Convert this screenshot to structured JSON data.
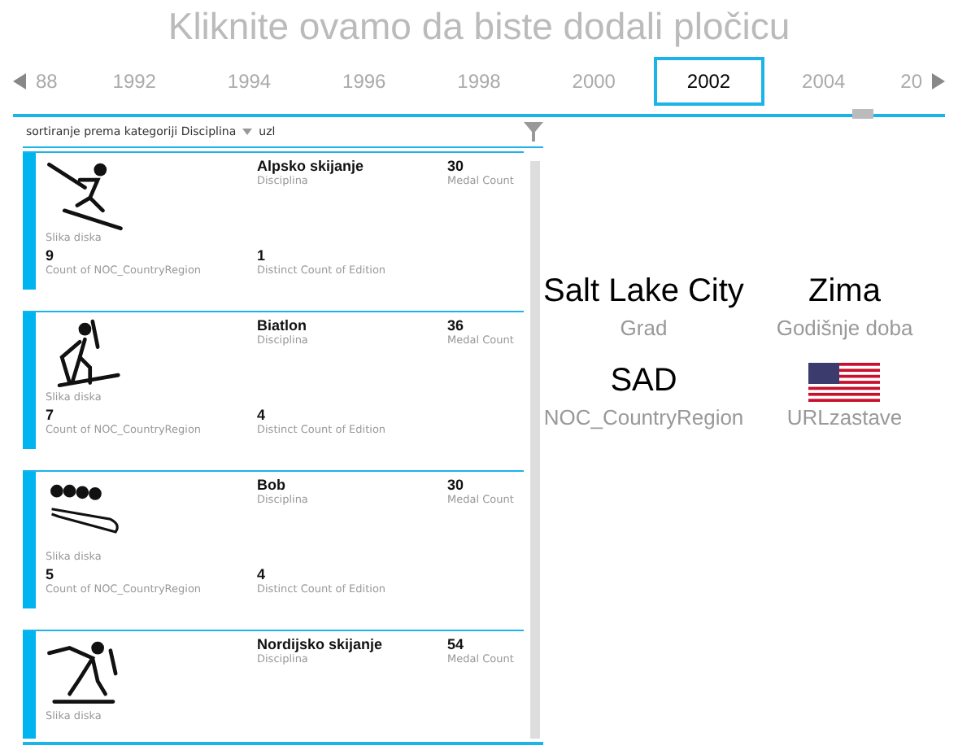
{
  "title": "Kliknite ovamo da biste dodali pločicu",
  "timeline": {
    "years": [
      {
        "label": "88",
        "selected": false
      },
      {
        "label": "1992",
        "selected": false
      },
      {
        "label": "1994",
        "selected": false
      },
      {
        "label": "1996",
        "selected": false
      },
      {
        "label": "1998",
        "selected": false
      },
      {
        "label": "2000",
        "selected": false
      },
      {
        "label": "2002",
        "selected": true
      },
      {
        "label": "2004",
        "selected": false
      },
      {
        "label": "20",
        "selected": false
      }
    ]
  },
  "sort": {
    "label": "sortiranje prema kategoriji Disciplina",
    "order": "uzl"
  },
  "cards": [
    {
      "kind": "alpine",
      "image_label": "Slika diska",
      "name": "Alpsko skijanje",
      "name_label": "Disciplina",
      "medals": "30",
      "medals_label": "Medal Count",
      "countries": "9",
      "countries_label": "Count of NOC_CountryRegion",
      "editions": "1",
      "editions_label": "Distinct Count of Edition"
    },
    {
      "kind": "biathlon",
      "image_label": "Slika diska",
      "name": "Biatlon",
      "name_label": "Disciplina",
      "medals": "36",
      "medals_label": "Medal Count",
      "countries": "7",
      "countries_label": "Count of NOC_CountryRegion",
      "editions": "4",
      "editions_label": "Distinct Count of Edition"
    },
    {
      "kind": "bobsleigh",
      "image_label": "Slika diska",
      "name": "Bob",
      "name_label": "Disciplina",
      "medals": "30",
      "medals_label": "Medal Count",
      "countries": "5",
      "countries_label": "Count of NOC_CountryRegion",
      "editions": "4",
      "editions_label": "Distinct Count of Edition"
    },
    {
      "kind": "nordic",
      "image_label": "Slika diska",
      "name": "Nordijsko skijanje",
      "name_label": "Disciplina",
      "medals": "54",
      "medals_label": "Medal Count"
    }
  ],
  "details": [
    {
      "kind": "text",
      "value": "Salt Lake City",
      "label": "Grad"
    },
    {
      "kind": "text",
      "value": "Zima",
      "label": "Godišnje doba"
    },
    {
      "kind": "text",
      "value": "SAD",
      "label": "NOC_CountryRegion"
    },
    {
      "kind": "flag",
      "label": "URLzastave"
    }
  ]
}
